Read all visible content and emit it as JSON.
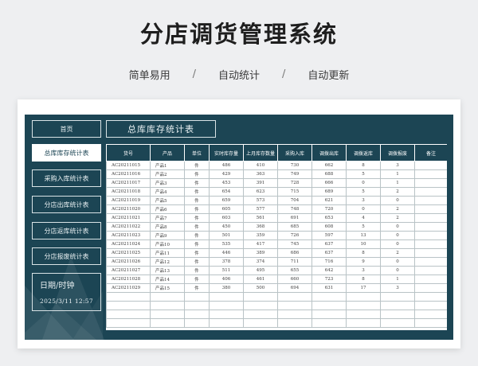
{
  "hero": {
    "title": "分店调货管理系统",
    "features": [
      "简单易用",
      "自动统计",
      "自动更新"
    ],
    "separator": "/"
  },
  "sidebar": {
    "items": [
      {
        "label": "首页",
        "active": false
      },
      {
        "label": "总库库存统计表",
        "active": true
      },
      {
        "label": "采购入库统计表",
        "active": false
      },
      {
        "label": "分店出库统计表",
        "active": false
      },
      {
        "label": "分店返库统计表",
        "active": false
      },
      {
        "label": "分店报废统计表",
        "active": false
      }
    ],
    "clock": {
      "label": "日期/时钟",
      "value": "2025/3/11  12:57"
    }
  },
  "table": {
    "title": "总库库存统计表",
    "columns": [
      "货号",
      "产品",
      "单位",
      "实时库存量",
      "上月库存数量",
      "采购入库",
      "调拨出库",
      "调拨返库",
      "调拨报废",
      "备注"
    ],
    "rows": [
      [
        "AC20211015",
        "产品1",
        "件",
        "486",
        "410",
        "730",
        "662",
        "8",
        "3",
        ""
      ],
      [
        "AC20211016",
        "产品2",
        "件",
        "429",
        "363",
        "749",
        "688",
        "5",
        "1",
        ""
      ],
      [
        "AC20211017",
        "产品3",
        "件",
        "453",
        "391",
        "728",
        "666",
        "0",
        "1",
        ""
      ],
      [
        "AC20211018",
        "产品4",
        "件",
        "654",
        "623",
        "715",
        "689",
        "5",
        "2",
        ""
      ],
      [
        "AC20211019",
        "产品5",
        "件",
        "659",
        "573",
        "704",
        "621",
        "3",
        "0",
        ""
      ],
      [
        "AC20211020",
        "产品6",
        "件",
        "605",
        "577",
        "748",
        "720",
        "0",
        "2",
        ""
      ],
      [
        "AC20211021",
        "产品7",
        "件",
        "603",
        "561",
        "691",
        "653",
        "4",
        "2",
        ""
      ],
      [
        "AC20211022",
        "产品8",
        "件",
        "450",
        "368",
        "685",
        "608",
        "5",
        "0",
        ""
      ],
      [
        "AC20211023",
        "产品9",
        "件",
        "501",
        "359",
        "726",
        "597",
        "13",
        "0",
        ""
      ],
      [
        "AC20211024",
        "产品10",
        "件",
        "535",
        "417",
        "745",
        "637",
        "10",
        "0",
        ""
      ],
      [
        "AC20211025",
        "产品11",
        "件",
        "446",
        "389",
        "686",
        "637",
        "8",
        "2",
        ""
      ],
      [
        "AC20211026",
        "产品12",
        "件",
        "378",
        "374",
        "711",
        "716",
        "9",
        "0",
        ""
      ],
      [
        "AC20211027",
        "产品13",
        "件",
        "511",
        "495",
        "655",
        "642",
        "3",
        "0",
        ""
      ],
      [
        "AC20211028",
        "产品14",
        "件",
        "406",
        "461",
        "660",
        "723",
        "8",
        "1",
        ""
      ],
      [
        "AC20211029",
        "产品15",
        "件",
        "380",
        "500",
        "694",
        "631",
        "17",
        "3",
        ""
      ],
      [
        "",
        "",
        "",
        "",
        "",
        "",
        "",
        "",
        "",
        ""
      ],
      [
        "",
        "",
        "",
        "",
        "",
        "",
        "",
        "",
        "",
        ""
      ],
      [
        "",
        "",
        "",
        "",
        "",
        "",
        "",
        "",
        "",
        ""
      ],
      [
        "",
        "",
        "",
        "",
        "",
        "",
        "",
        "",
        "",
        ""
      ]
    ]
  }
}
